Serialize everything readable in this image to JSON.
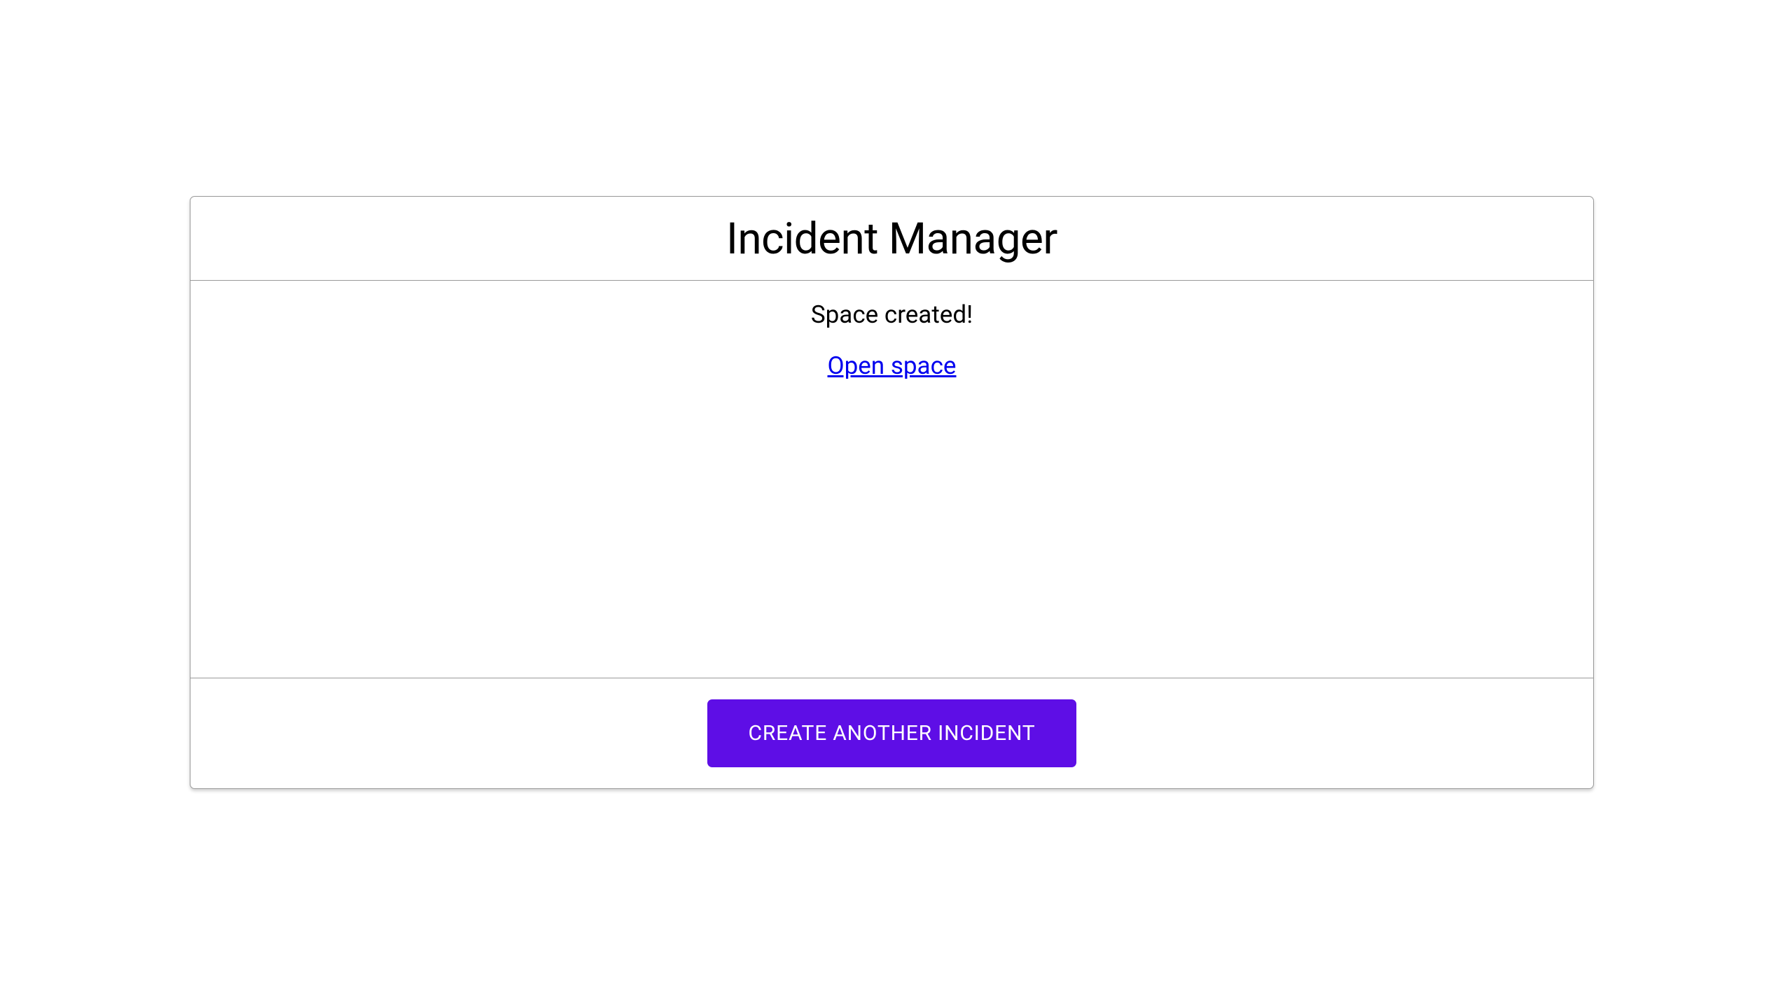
{
  "header": {
    "title": "Incident Manager"
  },
  "body": {
    "status_message": "Space created!",
    "link_label": "Open space"
  },
  "footer": {
    "button_label": "CREATE ANOTHER INCIDENT"
  },
  "colors": {
    "accent": "#5e0ee6",
    "border": "#999999",
    "link": "#0000ee"
  }
}
